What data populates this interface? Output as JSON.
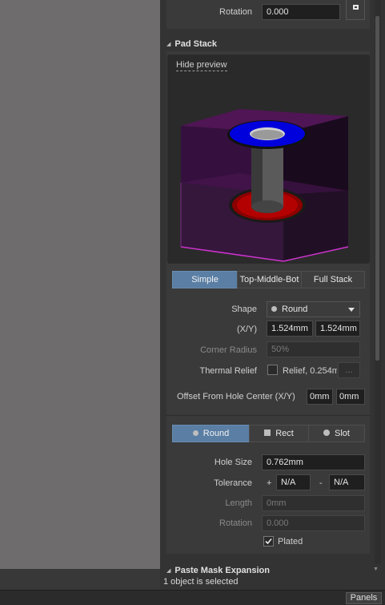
{
  "top": {
    "rotation_label": "Rotation",
    "rotation_value": "0.000"
  },
  "pad_stack": {
    "title": "Pad Stack",
    "hide_preview": "Hide preview",
    "tabs": [
      "Simple",
      "Top-Middle-Bot",
      "Full Stack"
    ],
    "active_tab": "Simple",
    "shape_label": "Shape",
    "shape_value": "Round",
    "xy_label": "(X/Y)",
    "x_value": "1.524mm",
    "y_value": "1.524mm",
    "corner_radius_label": "Corner Radius",
    "corner_radius_value": "50%",
    "thermal_relief_label": "Thermal Relief",
    "thermal_relief_value": "Relief, 0.254m",
    "thermal_relief_more": "...",
    "offset_label": "Offset From Hole Center (X/Y)",
    "offset_x": "0mm",
    "offset_y": "0mm"
  },
  "hole": {
    "tabs": [
      "Round",
      "Rect",
      "Slot"
    ],
    "active_tab": "Round",
    "hole_size_label": "Hole Size",
    "hole_size_value": "0.762mm",
    "tolerance_label": "Tolerance",
    "tol_plus_sign": "+",
    "tol_plus_value": "N/A",
    "tol_minus_sign": "-",
    "tol_minus_value": "N/A",
    "length_label": "Length",
    "length_value": "0mm",
    "rotation_label": "Rotation",
    "rotation_value": "0.000",
    "plated_label": "Plated",
    "plated_checked": true
  },
  "paste_mask": {
    "title": "Paste Mask Expansion"
  },
  "status": {
    "selection": "1 object is selected"
  },
  "bottom": {
    "panels_button": "Panels"
  },
  "colors": {
    "accent": "#5a7ea4",
    "pad_top": "#0000ff",
    "pad_bottom": "#cc0000",
    "pad_body": "#800080"
  }
}
